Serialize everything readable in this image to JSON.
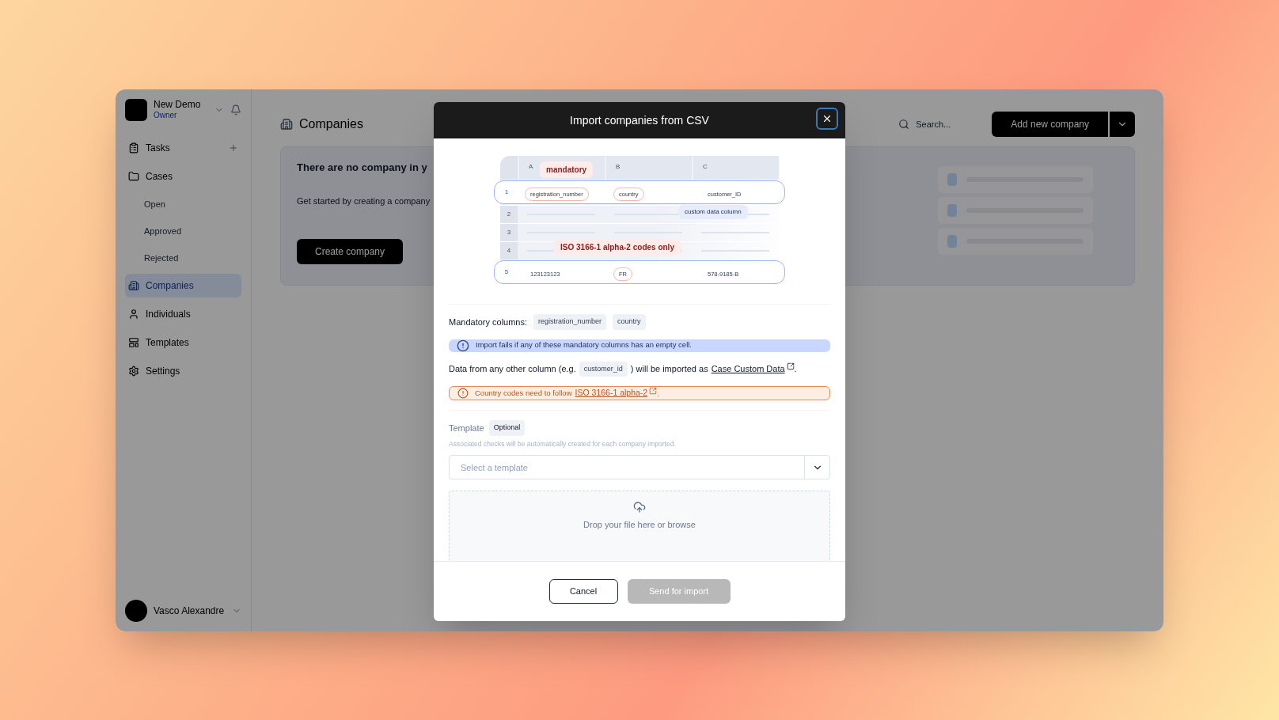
{
  "app": {
    "workspace": {
      "name": "New Demo",
      "role": "Owner"
    },
    "nav": [
      {
        "label": "Tasks",
        "selected": false
      },
      {
        "label": "Cases",
        "selected": false,
        "children": [
          {
            "label": "Open",
            "selected": false
          },
          {
            "label": "Approved",
            "selected": false
          },
          {
            "label": "Rejected",
            "selected": false
          }
        ]
      },
      {
        "label": "Companies",
        "selected": true
      },
      {
        "label": "Individuals",
        "selected": false
      },
      {
        "label": "Templates",
        "selected": false
      },
      {
        "label": "Settings",
        "selected": false
      }
    ],
    "user": {
      "name": "Vasco Alexandre"
    }
  },
  "page": {
    "title": "Companies",
    "search_placeholder": "Search...",
    "add_button": "Add new company",
    "empty_title": "There are no company in y",
    "empty_text": "Get started by creating a company",
    "create_button": "Create company"
  },
  "dialog": {
    "title": "Import companies from CSV",
    "sheet": {
      "columns": [
        "A",
        "B",
        "C"
      ],
      "rows": [
        {
          "number": "1",
          "kind": "data",
          "cells": [
            {
              "text": "registration_number",
              "marked": true
            },
            {
              "text": "country",
              "marked": true
            },
            {
              "text": "customer_ID",
              "marked": false
            }
          ]
        },
        {
          "number": "2",
          "kind": "blank"
        },
        {
          "number": "3",
          "kind": "blank"
        },
        {
          "number": "4",
          "kind": "blank"
        },
        {
          "number": "5",
          "kind": "data",
          "cells": [
            {
              "text": "123123123",
              "marked": false
            },
            {
              "text": "FR",
              "marked": true
            },
            {
              "text": "578-9185-B",
              "marked": false
            }
          ]
        }
      ],
      "callouts": [
        "mandatory",
        "custom data column",
        "ISO 3166-1 alpha-2 codes only"
      ]
    },
    "mandatory": {
      "label": "Mandatory columns:",
      "columns": [
        "registration_number",
        "country"
      ]
    },
    "info": "Import fails if any of these mandatory columns has an empty cell.",
    "custom_data": {
      "before": "Data from any other column (e.g.",
      "example": "customer_id",
      "after": ") will be imported as",
      "link": "Case Custom Data",
      "end": "."
    },
    "warning": {
      "before": "Country codes need to follow",
      "link": "ISO 3166-1 alpha-2",
      "end": "."
    },
    "template": {
      "label": "Template",
      "badge": "Optional",
      "help": "Associated checks will be automatically created for each company imported.",
      "placeholder": "Select a template"
    },
    "dropzone": "Drop your file here or browse",
    "buttons": [
      {
        "label": "Cancel",
        "kind": "secondary",
        "disabled": false
      },
      {
        "label": "Send for import",
        "kind": "primary",
        "disabled": true
      }
    ]
  }
}
